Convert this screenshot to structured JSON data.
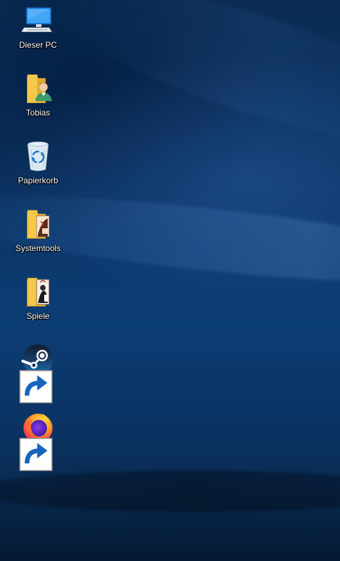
{
  "desktop": {
    "icons": [
      {
        "label": "Dieser PC",
        "icon": "this-pc-icon"
      },
      {
        "label": "Tobias",
        "icon": "user-folder-icon"
      },
      {
        "label": "Papierkorb",
        "icon": "recycle-bin-icon"
      },
      {
        "label": "Systemtools",
        "icon": "folder-icon"
      },
      {
        "label": "Spiele",
        "icon": "folder-icon"
      },
      {
        "label": "Steam",
        "icon": "steam-icon",
        "shortcut": true
      },
      {
        "label": "Firefox",
        "icon": "firefox-icon",
        "shortcut": true
      }
    ]
  },
  "colors": {
    "wallpaper_base": "#0b3465",
    "label_text": "#ffffff",
    "folder_yellow": "#f3c84b",
    "steam_dark": "#1b2838",
    "firefox_orange": "#ff7139"
  }
}
